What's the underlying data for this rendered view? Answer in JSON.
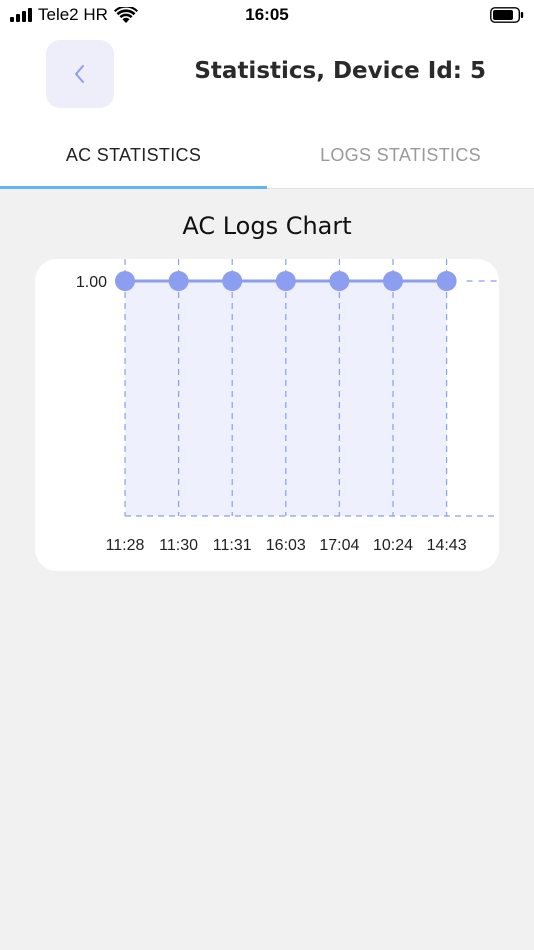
{
  "status_bar": {
    "carrier": "Tele2 HR",
    "time": "16:05",
    "icons": [
      "signal-icon",
      "wifi-icon",
      "battery-icon"
    ]
  },
  "header": {
    "back_icon": "chevron-left-icon",
    "title": "Statistics, Device Id: 5"
  },
  "tabs": [
    {
      "label": "AC STATISTICS",
      "active": true
    },
    {
      "label": "LOGS STATISTICS",
      "active": false
    }
  ],
  "colors": {
    "accent": "#8c9ef0",
    "tab_indicator": "#64b5f6",
    "back_button_bg": "#eeeefb",
    "area_fill": "#eef1fd"
  },
  "chart_data": {
    "type": "line",
    "title": "AC Logs Chart",
    "categories": [
      "11:28",
      "11:30",
      "11:31",
      "16:03",
      "17:04",
      "10:24",
      "14:43"
    ],
    "series": [
      {
        "values": [
          1,
          1,
          1,
          1,
          1,
          1,
          1
        ]
      }
    ],
    "yticks": [
      "1.00"
    ],
    "ylim": [
      0,
      1
    ],
    "grid": true,
    "legend": "none"
  }
}
